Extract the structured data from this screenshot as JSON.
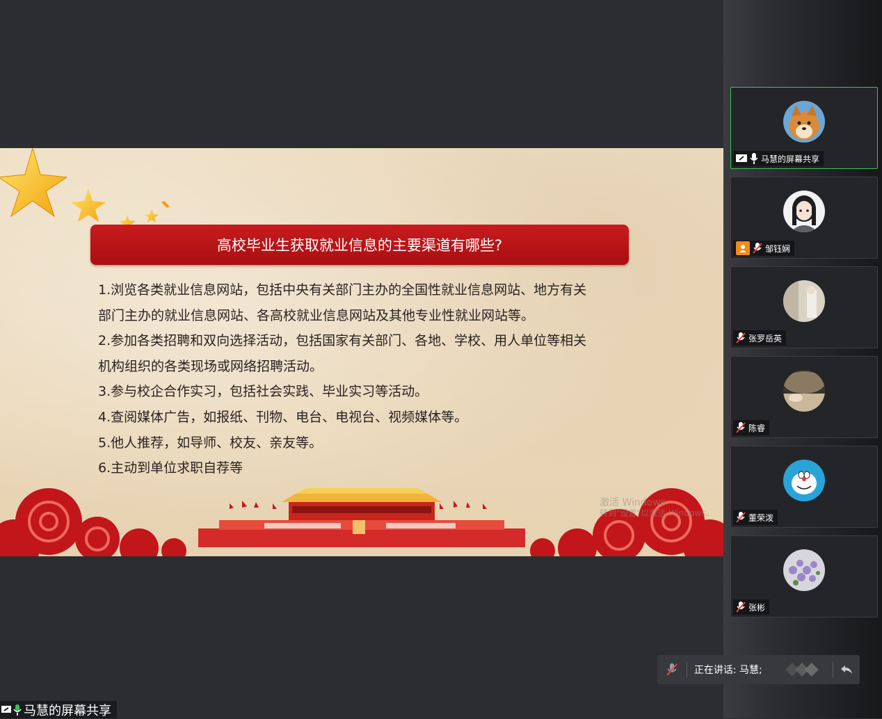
{
  "slide": {
    "title": "高校毕业生获取就业信息的主要渠道有哪些?",
    "lines": [
      "1.浏览各类就业信息网站，包括中央有关部门主办的全国性就业信息网站、地方有关",
      "部门主办的就业信息网站、各高校就业信息网站及其他专业性就业网站等。",
      "2.参加各类招聘和双向选择活动，包括国家有关部门、各地、学校、用人单位等相关",
      "机构组织的各类现场或网络招聘活动。",
      "3.参与校企合作实习，包括社会实践、毕业实习等活动。",
      "4.查阅媒体广告，如报纸、刊物、电台、电视台、视频媒体等。",
      "5.他人推荐，如导师、校友、亲友等。",
      "6.主动到单位求职自荐等"
    ],
    "watermark": {
      "line1": "激活 Windows",
      "line2": "转到\"设置\"以激活 Windows。"
    }
  },
  "share_label": "马慧的屏幕共享",
  "participants": [
    {
      "name": "马慧的屏幕共享",
      "avatar": "shiba-dog-avatar",
      "active": true
    },
    {
      "name": "邹钰娴",
      "avatar": "anime-girl-avatar"
    },
    {
      "name": "张罗岳英",
      "avatar": "room-photo-avatar"
    },
    {
      "name": "陈睿",
      "avatar": "landscape-avatar"
    },
    {
      "name": "董荣泼",
      "avatar": "doraemon-avatar"
    },
    {
      "name": "张彬",
      "avatar": "flower-avatar"
    }
  ],
  "speaking": {
    "text": "正在讲话: 马慧;"
  },
  "colors": {
    "accent_red": "#b8151a",
    "active_border": "#39c55a",
    "mic_muted": "#e0483a",
    "badge_orange": "#f28a1c"
  }
}
